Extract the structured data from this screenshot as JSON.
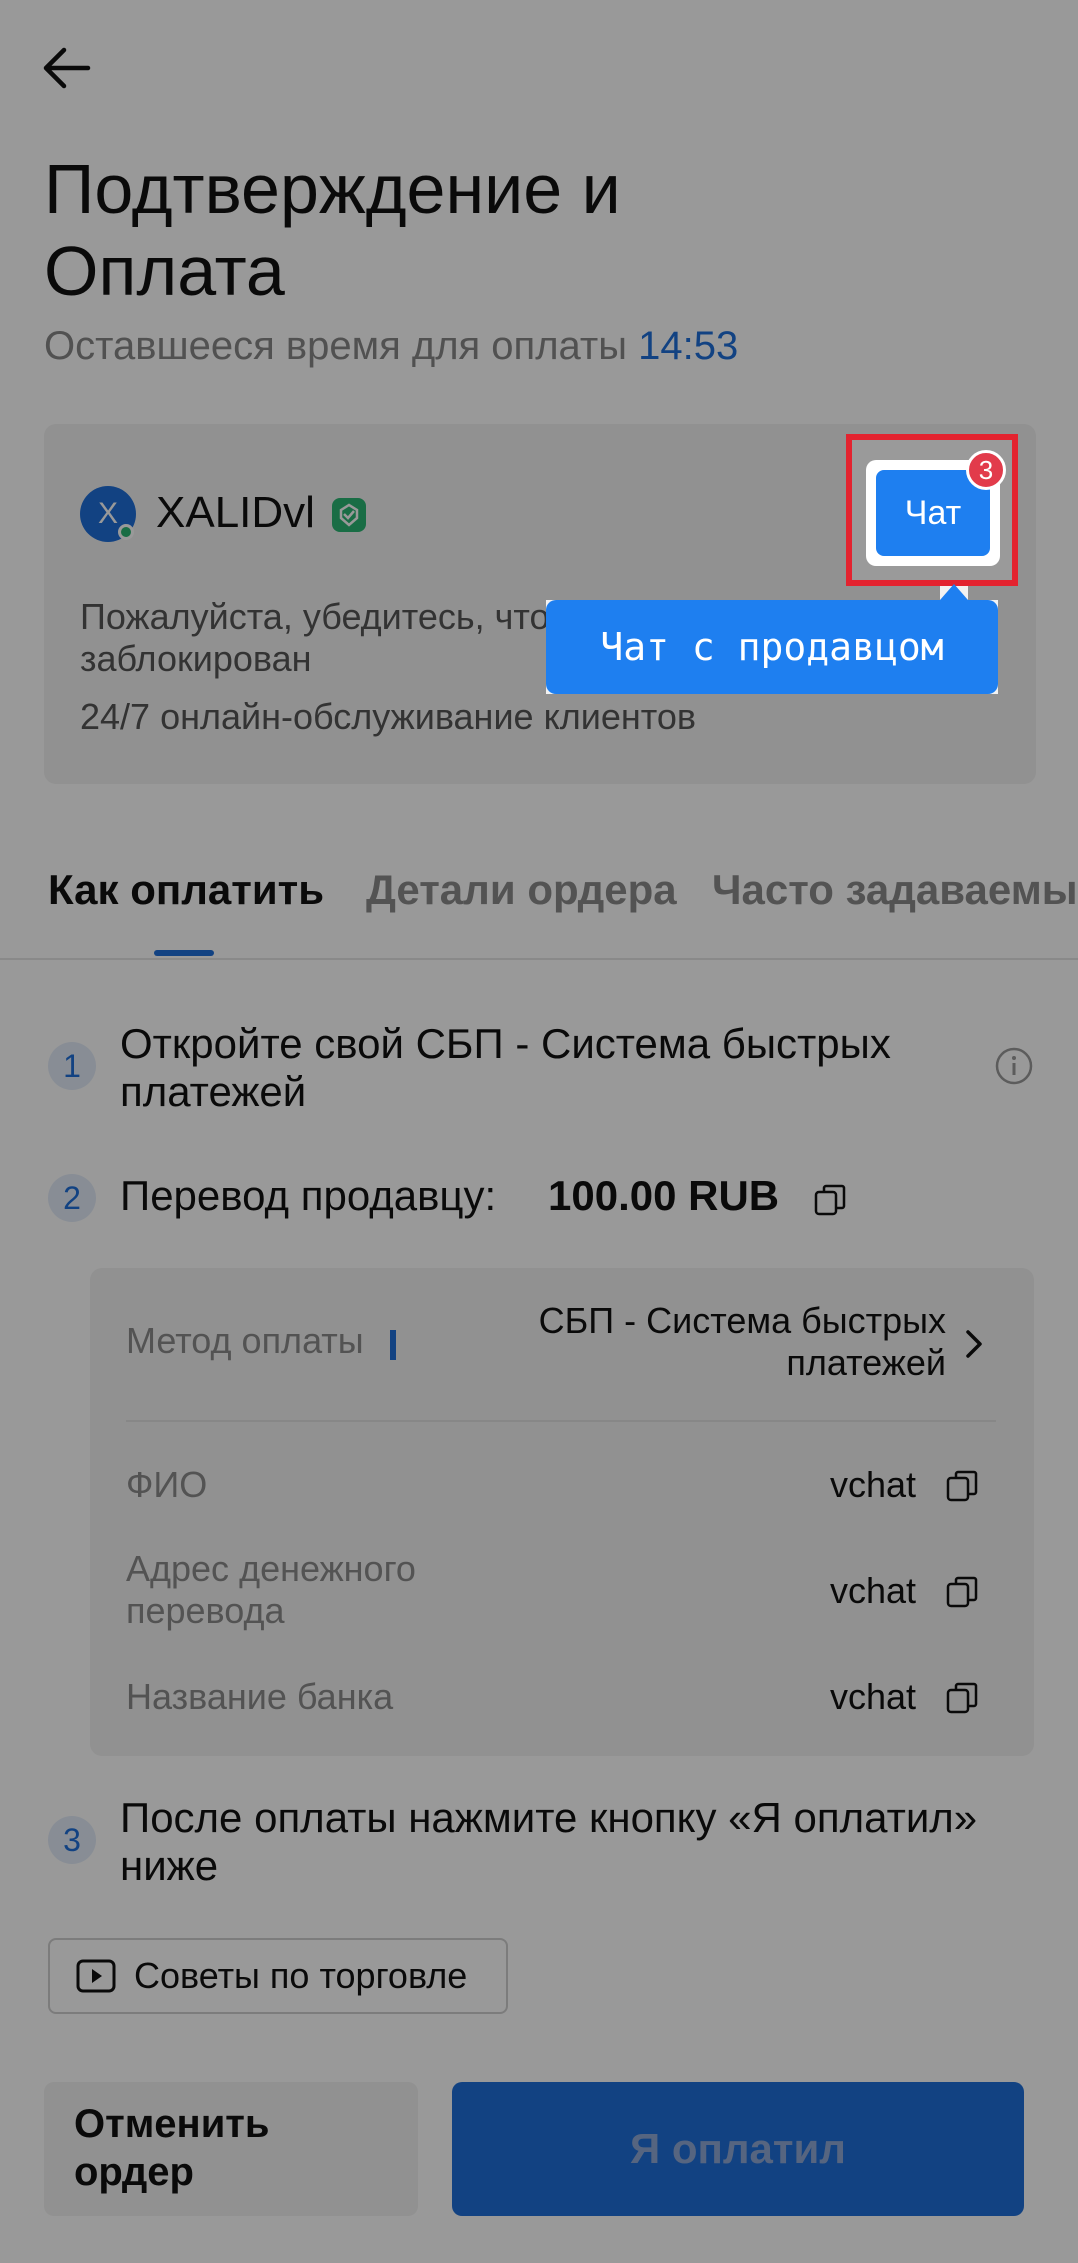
{
  "header": {
    "title_line1": "Подтверждение и",
    "title_line2": "Оплата",
    "timer_label": "Оставшееся время для оплаты",
    "timer_value": "14:53"
  },
  "seller": {
    "avatar_letter": "X",
    "name": "XALIDvl",
    "notice": "Пожалуйста, убедитесь, что",
    "notice_line2": "заблокирован",
    "support": "24/7 онлайн-обслуживание клиентов",
    "chat_label": "Чат",
    "chat_badge": "3",
    "tooltip": "Чат с продавцом"
  },
  "tabs": [
    {
      "label": "Как оплатить",
      "active": true
    },
    {
      "label": "Детали ордера",
      "active": false
    },
    {
      "label": "Часто задаваемы",
      "active": false
    }
  ],
  "steps": {
    "s1_num": "1",
    "s1_text": "Откройте свой СБП - Система быстрых платежей",
    "s2_num": "2",
    "s2_text": "Перевод продавцу:",
    "s2_amount": "100.00 RUB",
    "s3_num": "3",
    "s3_text": "После оплаты нажмите кнопку «Я оплатил» ниже"
  },
  "payment": {
    "method_label": "Метод оплаты",
    "method_value": "СБП - Система быстрых платежей",
    "fields": [
      {
        "label": "ФИО",
        "value": "vchat"
      },
      {
        "label": "Адрес денежного перевода",
        "value": "vchat"
      },
      {
        "label": "Название банка",
        "value": "vchat"
      }
    ]
  },
  "tips_button": "Советы по торговле",
  "actions": {
    "cancel": "Отменить ордер",
    "paid": "Я оплатил"
  },
  "colors": {
    "accent": "#1e6fd9",
    "highlight": "#e3232f",
    "badge": "#e23b4b"
  }
}
